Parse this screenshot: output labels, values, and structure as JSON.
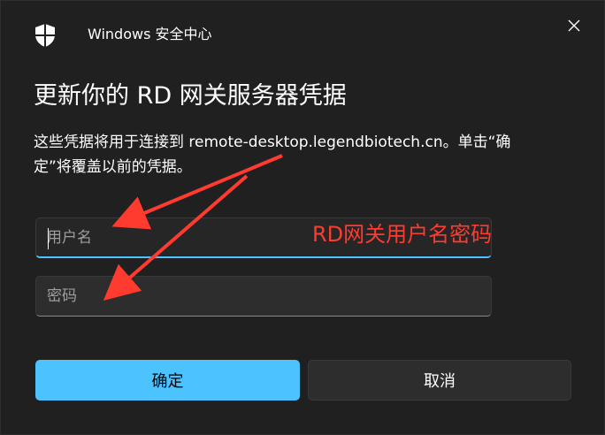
{
  "window": {
    "app_title": "Windows 安全中心",
    "close_glyph": "✕"
  },
  "dialog": {
    "heading": "更新你的 RD 网关服务器凭据",
    "description": "这些凭据将用于连接到 remote-desktop.legendbiotech.cn。单击“确定”将覆盖以前的凭据。"
  },
  "form": {
    "username_placeholder": "用户名",
    "username_value": "",
    "password_placeholder": "密码",
    "password_value": ""
  },
  "annotation": {
    "text": "RD网关用户名密码",
    "color": "#ff3b30"
  },
  "buttons": {
    "ok_label": "确定",
    "cancel_label": "取消"
  },
  "colors": {
    "accent": "#4cc2ff",
    "background": "#202020",
    "field": "#2d2d2d"
  },
  "icons": {
    "app": "shield-icon",
    "close": "close-icon"
  }
}
